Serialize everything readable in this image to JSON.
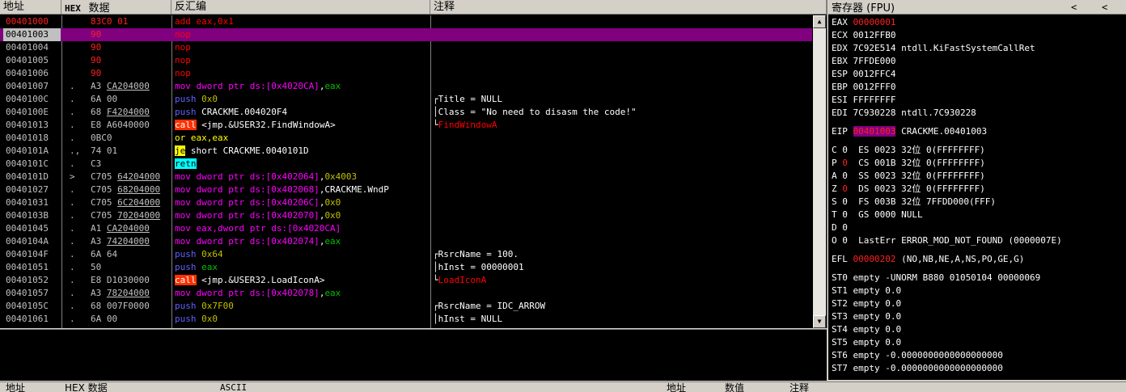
{
  "headers": {
    "address": "地址",
    "hex_label": "HEX",
    "hex_data": "数据",
    "disasm": "反汇编",
    "comment": "注释"
  },
  "rows": [
    {
      "addr": "00401000",
      "mark": "",
      "hex": "83C0 01",
      "dis": [
        [
          "r",
          "add eax,0x1"
        ]
      ],
      "cmt": [],
      "addrColor": "red",
      "hexColor": "red"
    },
    {
      "addr": "00401003",
      "mark": "",
      "hex": "90",
      "dis": [
        [
          "r",
          "nop"
        ]
      ],
      "cmt": [],
      "selected": true,
      "hexColor": "red"
    },
    {
      "addr": "00401004",
      "mark": "",
      "hex": "90",
      "dis": [
        [
          "r",
          "nop"
        ]
      ],
      "cmt": [],
      "hexColor": "red"
    },
    {
      "addr": "00401005",
      "mark": "",
      "hex": "90",
      "dis": [
        [
          "r",
          "nop"
        ]
      ],
      "cmt": [],
      "hexColor": "red"
    },
    {
      "addr": "00401006",
      "mark": "",
      "hex": "90",
      "dis": [
        [
          "r",
          "nop"
        ]
      ],
      "cmt": [],
      "hexColor": "red"
    },
    {
      "addr": "00401007",
      "mark": ".",
      "hex": "A3 CA204000",
      "hexU": "CA204000",
      "dis": [
        [
          "mag",
          "mov dword ptr ds:[0x4020CA]"
        ],
        [
          "w",
          ","
        ],
        [
          "grn",
          "eax"
        ]
      ],
      "cmt": []
    },
    {
      "addr": "0040100C",
      "mark": ".",
      "hex": "6A 00",
      "dis": [
        [
          "blu",
          "push "
        ],
        [
          "olv",
          "0x0"
        ]
      ],
      "cmt": [
        [
          "w",
          "┌Title = NULL"
        ]
      ]
    },
    {
      "addr": "0040100E",
      "mark": ".",
      "hex": "68 F4204000",
      "hexU": "F4204000",
      "dis": [
        [
          "blu",
          "push "
        ],
        [
          "w",
          "CRACKME.004020F4"
        ]
      ],
      "cmt": [
        [
          "w",
          "│Class = \"No need to disasm the code!\""
        ]
      ]
    },
    {
      "addr": "00401013",
      "mark": ".",
      "hex": "E8 A6040000",
      "dis": [
        [
          "callbg",
          "call"
        ],
        [
          "w",
          " <jmp.&USER32.FindWindowA>"
        ]
      ],
      "cmt": [
        [
          "w",
          "└"
        ],
        [
          "r",
          "FindWindowA"
        ]
      ]
    },
    {
      "addr": "00401018",
      "mark": ".",
      "hex": "0BC0",
      "dis": [
        [
          "yel",
          "or "
        ],
        [
          "yel",
          "eax,eax"
        ]
      ],
      "cmt": []
    },
    {
      "addr": "0040101A",
      "mark": ".,",
      "hex": "74 01",
      "dis": [
        [
          "jebg",
          "je"
        ],
        [
          "w",
          " short CRACKME.0040101D"
        ]
      ],
      "cmt": []
    },
    {
      "addr": "0040101C",
      "mark": ".",
      "hex": "C3",
      "dis": [
        [
          "retbg",
          "retn"
        ]
      ],
      "cmt": []
    },
    {
      "addr": "0040101D",
      "mark": ">",
      "hex": "C705 64204000",
      "hexU": "64204000",
      "dis": [
        [
          "mag",
          "mov dword ptr ds:[0x402064]"
        ],
        [
          "w",
          ","
        ],
        [
          "olv",
          "0x4003"
        ]
      ],
      "cmt": []
    },
    {
      "addr": "00401027",
      "mark": ".",
      "hex": "C705 68204000",
      "hexU": "68204000",
      "dis": [
        [
          "mag",
          "mov dword ptr ds:[0x402068]"
        ],
        [
          "w",
          ",CRACKME.WndP"
        ]
      ],
      "cmt": []
    },
    {
      "addr": "00401031",
      "mark": ".",
      "hex": "C705 6C204000",
      "hexU": "6C204000",
      "dis": [
        [
          "mag",
          "mov dword ptr ds:[0x40206C]"
        ],
        [
          "w",
          ","
        ],
        [
          "olv",
          "0x0"
        ]
      ],
      "cmt": []
    },
    {
      "addr": "0040103B",
      "mark": ".",
      "hex": "C705 70204000",
      "hexU": "70204000",
      "dis": [
        [
          "mag",
          "mov dword ptr ds:[0x402070]"
        ],
        [
          "w",
          ","
        ],
        [
          "olv",
          "0x0"
        ]
      ],
      "cmt": []
    },
    {
      "addr": "00401045",
      "mark": ".",
      "hex": "A1 CA204000",
      "hexU": "CA204000",
      "dis": [
        [
          "mag",
          "mov eax,dword ptr ds:[0x4020CA]"
        ]
      ],
      "cmt": []
    },
    {
      "addr": "0040104A",
      "mark": ".",
      "hex": "A3 74204000",
      "hexU": "74204000",
      "dis": [
        [
          "mag",
          "mov dword ptr ds:[0x402074]"
        ],
        [
          "w",
          ","
        ],
        [
          "grn",
          "eax"
        ]
      ],
      "cmt": []
    },
    {
      "addr": "0040104F",
      "mark": ".",
      "hex": "6A 64",
      "dis": [
        [
          "blu",
          "push "
        ],
        [
          "olv",
          "0x64"
        ]
      ],
      "cmt": [
        [
          "w",
          "┌RsrcName = 100."
        ]
      ]
    },
    {
      "addr": "00401051",
      "mark": ".",
      "hex": "50",
      "dis": [
        [
          "blu",
          "push "
        ],
        [
          "grn",
          "eax"
        ]
      ],
      "cmt": [
        [
          "w",
          "│hInst = 00000001"
        ]
      ]
    },
    {
      "addr": "00401052",
      "mark": ".",
      "hex": "E8 D1030000",
      "dis": [
        [
          "callbg",
          "call"
        ],
        [
          "w",
          " <jmp.&USER32.LoadIconA>"
        ]
      ],
      "cmt": [
        [
          "w",
          "└"
        ],
        [
          "r",
          "LoadIconA"
        ]
      ]
    },
    {
      "addr": "00401057",
      "mark": ".",
      "hex": "A3 78204000",
      "hexU": "78204000",
      "dis": [
        [
          "mag",
          "mov dword ptr ds:[0x402078]"
        ],
        [
          "w",
          ","
        ],
        [
          "grn",
          "eax"
        ]
      ],
      "cmt": []
    },
    {
      "addr": "0040105C",
      "mark": ".",
      "hex": "68 007F0000",
      "dis": [
        [
          "blu",
          "push "
        ],
        [
          "olv",
          "0x7F00"
        ]
      ],
      "cmt": [
        [
          "w",
          "┌RsrcName = IDC_ARROW"
        ]
      ]
    },
    {
      "addr": "00401061",
      "mark": ".",
      "hex": "6A 00",
      "dis": [
        [
          "blu",
          "push "
        ],
        [
          "olv",
          "0x0"
        ]
      ],
      "cmt": [
        [
          "w",
          "│hInst = NULL"
        ]
      ]
    }
  ],
  "registers": {
    "title": "寄存器 (FPU)",
    "nav_prev": "<",
    "nav_next": "<",
    "lines": [
      {
        "t": "EAX ",
        "v": "00000001",
        "vc": "red"
      },
      {
        "t": "ECX 0012FFB0"
      },
      {
        "t": "EDX 7C92E514 ntdll.KiFastSystemCallRet"
      },
      {
        "t": "EBX 7FFDE000"
      },
      {
        "t": "ESP 0012FFC4"
      },
      {
        "t": "EBP 0012FFF0"
      },
      {
        "t": "ESI FFFFFFFF"
      },
      {
        "t": "EDI 7C930228 ntdll.7C930228"
      },
      {
        "t": "",
        "gap": true
      },
      {
        "t": "EIP ",
        "eip": "00401003",
        "rest": " CRACKME.00401003"
      },
      {
        "t": "",
        "gap": true
      },
      {
        "t": "C 0  ES 0023 32位 0(FFFFFFFF)"
      },
      {
        "t": "P ",
        "flag": "0",
        "rest": "  CS 001B 32位 0(FFFFFFFF)"
      },
      {
        "t": "A 0  SS 0023 32位 0(FFFFFFFF)"
      },
      {
        "t": "Z ",
        "flag": "0",
        "rest": "  DS 0023 32位 0(FFFFFFFF)"
      },
      {
        "t": "S 0  FS 003B 32位 7FFDD000(FFF)"
      },
      {
        "t": "T 0  GS 0000 NULL"
      },
      {
        "t": "D 0"
      },
      {
        "t": "O 0  LastErr ERROR_MOD_NOT_FOUND (0000007E)"
      },
      {
        "t": "",
        "gap": true
      },
      {
        "t": "EFL ",
        "v": "00000202",
        "vc": "red",
        "rest": " (NO,NB,NE,A,NS,PO,GE,G)"
      },
      {
        "t": "",
        "gap": true
      },
      {
        "t": "ST0 empty -UNORM B880 01050104 00000069"
      },
      {
        "t": "ST1 empty 0.0"
      },
      {
        "t": "ST2 empty 0.0"
      },
      {
        "t": "ST3 empty 0.0"
      },
      {
        "t": "ST4 empty 0.0"
      },
      {
        "t": "ST5 empty 0.0"
      },
      {
        "t": "ST6 empty -0.0000000000000000000"
      },
      {
        "t": "ST7 empty -0.0000000000000000000"
      }
    ]
  },
  "dump": {
    "address": "地址",
    "hex": "HEX 数据",
    "ascii": "ASCII",
    "stack_address": "地址",
    "stack_value": "数值",
    "stack_comment": "注释"
  },
  "colors": {
    "background": "#000000",
    "selected_row": "#800080",
    "panel": "#d4d0c8"
  }
}
